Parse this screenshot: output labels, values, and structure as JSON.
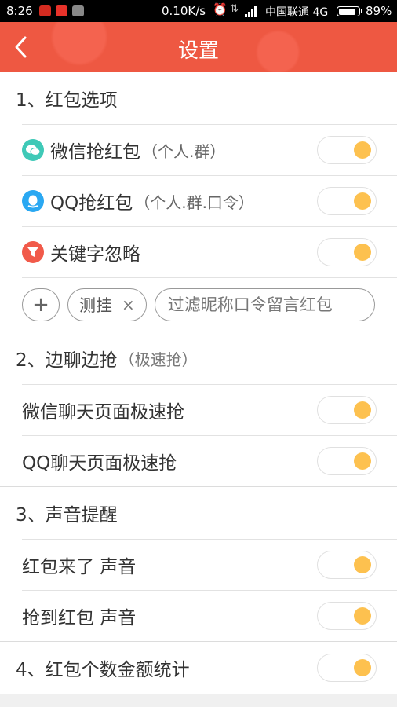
{
  "status": {
    "time": "8:26",
    "net_speed": "0.10K/s",
    "carrier": "中国联通 4G",
    "battery": "89%",
    "battery_level": 0.89
  },
  "header": {
    "title": "设置"
  },
  "section1": {
    "title": "1、红包选项",
    "wechat": {
      "label": "微信抢红包",
      "note": "（个人.群）",
      "on": true
    },
    "qq": {
      "label": "QQ抢红包",
      "note": "（个人.群.口令）",
      "on": true
    },
    "keyword": {
      "label": "关键字忽略",
      "on": true
    },
    "chips": {
      "add": "+",
      "tag": "测挂",
      "tag_remove": "×",
      "placeholder": "过滤昵称口令留言红包"
    }
  },
  "section2": {
    "title": "2、边聊边抢",
    "note": "（极速抢）",
    "wechat_chat": {
      "label": "微信聊天页面极速抢",
      "on": true
    },
    "qq_chat": {
      "label": "QQ聊天页面极速抢",
      "on": true
    }
  },
  "section3": {
    "title": "3、声音提醒",
    "arrive": {
      "label": "红包来了 声音",
      "on": true
    },
    "grabbed": {
      "label": "抢到红包 声音",
      "on": true
    }
  },
  "section4": {
    "title": "4、红包个数金额统计",
    "on": true
  },
  "colors": {
    "header": "#ee5842",
    "knob": "#fdc14f",
    "wechat": "#3fc9b7",
    "qq": "#2aa8f2",
    "filter": "#f15a4a"
  }
}
